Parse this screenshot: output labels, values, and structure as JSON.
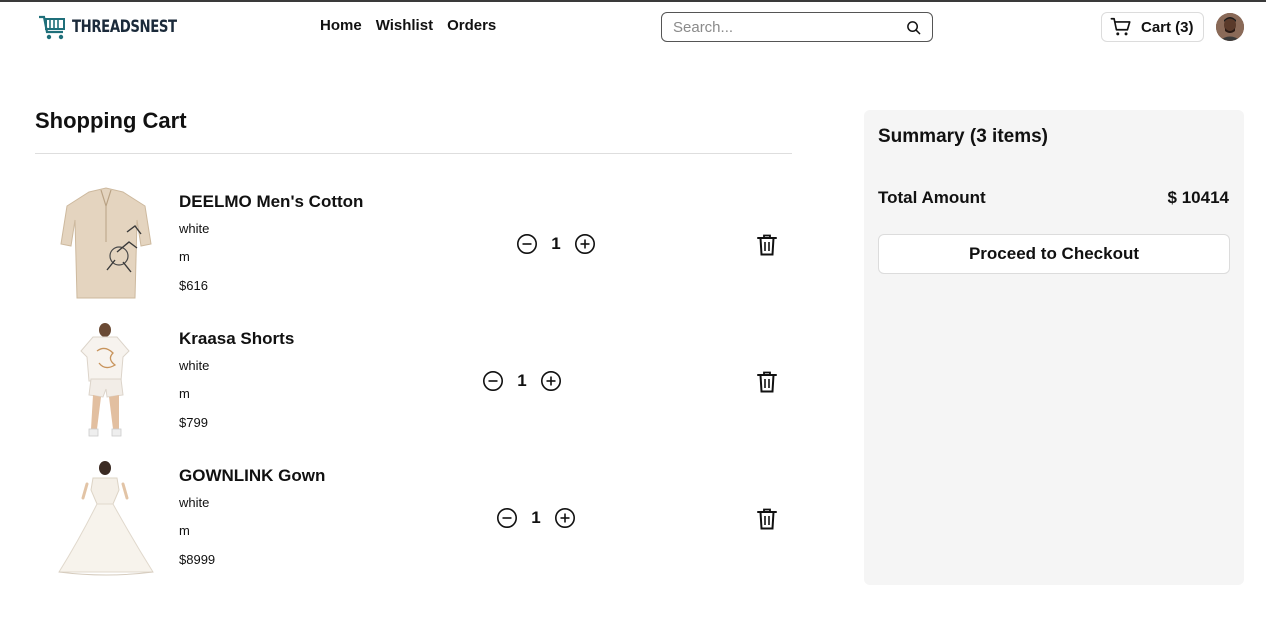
{
  "header": {
    "brand": "THREADSNEST",
    "nav": [
      "Home",
      "Wishlist",
      "Orders"
    ],
    "search_placeholder": "Search...",
    "cart_label": "Cart (3)"
  },
  "cart": {
    "title": "Shopping Cart",
    "items": [
      {
        "name": "DEELMO Men's Cotton",
        "color": "white",
        "size": "m",
        "price": "$616",
        "quantity": "1"
      },
      {
        "name": "Kraasa Shorts",
        "color": "white",
        "size": "m",
        "price": "$799",
        "quantity": "1"
      },
      {
        "name": "GOWNLINK Gown",
        "color": "white",
        "size": "m",
        "price": "$8999",
        "quantity": "1"
      }
    ]
  },
  "summary": {
    "title": "Summary (3 items)",
    "total_label": "Total Amount",
    "total_value": "$ 10414",
    "checkout_label": "Proceed to Checkout"
  },
  "colors": {
    "brand": "#1f6f7a",
    "summary_bg": "#f5f5f5",
    "text": "#111111"
  }
}
